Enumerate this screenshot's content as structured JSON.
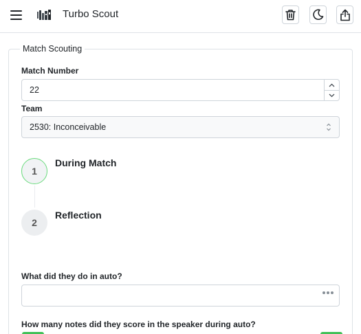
{
  "header": {
    "menu_icon": "hamburger-menu-icon",
    "logo_icon": "turbo-scout-logo",
    "title": "Turbo Scout",
    "actions": [
      {
        "name": "delete-button",
        "icon": "trash-icon"
      },
      {
        "name": "dark-mode-toggle",
        "icon": "moon-icon"
      },
      {
        "name": "share-button",
        "icon": "share-icon"
      }
    ]
  },
  "form": {
    "legend": "Match Scouting",
    "match_number": {
      "label": "Match Number",
      "value": "22"
    },
    "team": {
      "label": "Team",
      "selected": "2530: Inconceivable"
    },
    "steps": [
      {
        "number": "1",
        "title": "During Match",
        "state": "active"
      },
      {
        "number": "2",
        "title": "Reflection",
        "state": "inactive"
      }
    ],
    "auto_question": {
      "label": "What did they do in auto?",
      "value": ""
    },
    "speaker_question": {
      "label": "How many notes did they score in the speaker during auto?"
    }
  },
  "colors": {
    "accent_green": "#40c057",
    "active_step_border": "#69db7c",
    "border": "#ced4da"
  }
}
